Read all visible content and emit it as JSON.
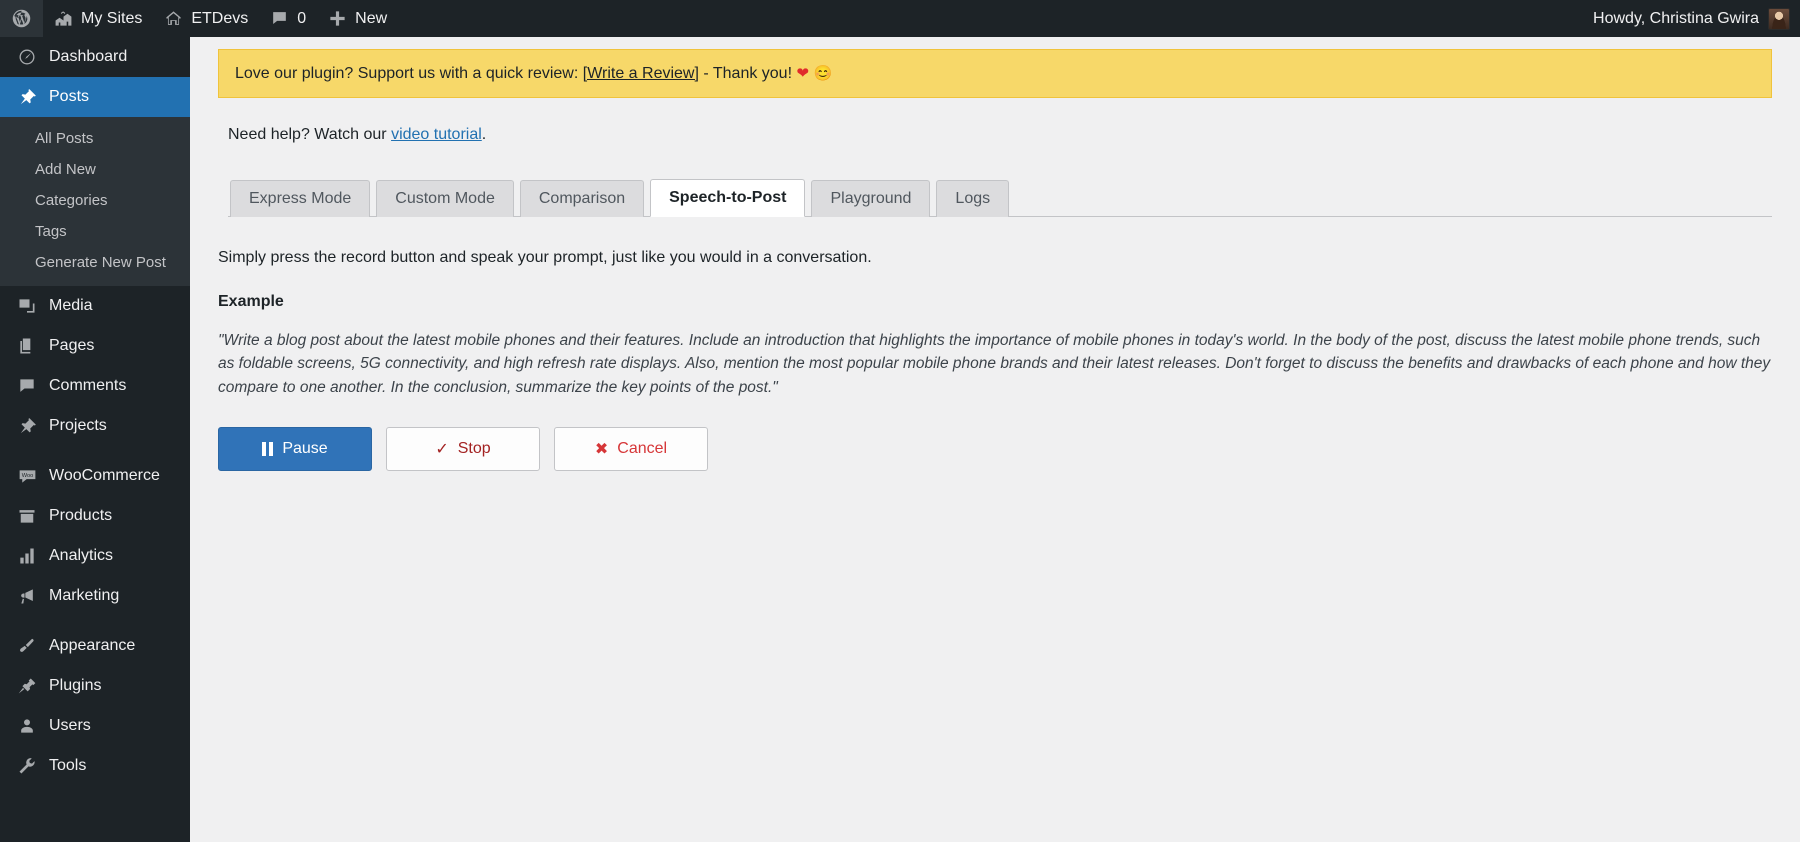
{
  "adminbar": {
    "wp_logo_label": "WordPress",
    "items": [
      {
        "icon": "wordpress-icon",
        "label": ""
      },
      {
        "icon": "sites-icon",
        "label": "My Sites"
      },
      {
        "icon": "home-icon",
        "label": "ETDevs"
      },
      {
        "icon": "comment-icon",
        "label": "0"
      },
      {
        "icon": "plus-icon",
        "label": "New"
      }
    ],
    "howdy": "Howdy, Christina Gwira"
  },
  "sidebar": {
    "items": [
      {
        "label": "Dashboard",
        "icon": "dashboard-icon",
        "current": false
      },
      {
        "label": "Posts",
        "icon": "pin-icon",
        "current": true
      },
      {
        "label": "Media",
        "icon": "media-icon",
        "current": false
      },
      {
        "label": "Pages",
        "icon": "pages-icon",
        "current": false
      },
      {
        "label": "Comments",
        "icon": "comments-icon",
        "current": false
      },
      {
        "label": "Projects",
        "icon": "pin-icon",
        "current": false
      },
      {
        "label": "WooCommerce",
        "icon": "woo-icon",
        "current": false
      },
      {
        "label": "Products",
        "icon": "products-icon",
        "current": false
      },
      {
        "label": "Analytics",
        "icon": "analytics-icon",
        "current": false
      },
      {
        "label": "Marketing",
        "icon": "megaphone-icon",
        "current": false
      },
      {
        "label": "Appearance",
        "icon": "brush-icon",
        "current": false
      },
      {
        "label": "Plugins",
        "icon": "plug-icon",
        "current": false
      },
      {
        "label": "Users",
        "icon": "user-icon",
        "current": false
      },
      {
        "label": "Tools",
        "icon": "wrench-icon",
        "current": false
      }
    ],
    "posts_submenu": [
      "All Posts",
      "Add New",
      "Categories",
      "Tags",
      "Generate New Post"
    ]
  },
  "notice": {
    "text_before": "Love our plugin? Support us with a quick review: ",
    "link": "[Write a Review]",
    "text_after": " - Thank you! ",
    "emoji_heart": "❤",
    "emoji_smile": "😊",
    "background": "#f7d869"
  },
  "help": {
    "text_before": "Need help? Watch our ",
    "link": "video tutorial",
    "text_after": "."
  },
  "tabs": [
    {
      "label": "Express Mode",
      "active": false
    },
    {
      "label": "Custom Mode",
      "active": false
    },
    {
      "label": "Comparison",
      "active": false
    },
    {
      "label": "Speech-to-Post",
      "active": true
    },
    {
      "label": "Playground",
      "active": false
    },
    {
      "label": "Logs",
      "active": false
    }
  ],
  "main": {
    "intro": "Simply press the record button and speak your prompt, just like you would in a conversation.",
    "example_label": "Example",
    "example_text": "\"Write a blog post about the latest mobile phones and their features. Include an introduction that highlights the importance of mobile phones in today's world. In the body of the post, discuss the latest mobile phone trends, such as foldable screens, 5G connectivity, and high refresh rate displays. Also, mention the most popular mobile phone brands and their latest releases. Don't forget to discuss the benefits and drawbacks of each phone and how they compare to one another. In the conclusion, summarize the key points of the post.\"",
    "buttons": {
      "pause": "Pause",
      "stop": "Stop",
      "cancel": "Cancel",
      "stop_glyph": "✓",
      "cancel_glyph": "✖"
    }
  },
  "colors": {
    "admin_bar": "#1d2327",
    "sidebar": "#1d2327",
    "current_menu": "#2271b1",
    "notice_yellow": "#f7d869",
    "primary_button": "#3073b8",
    "cancel_red": "#d63638"
  }
}
